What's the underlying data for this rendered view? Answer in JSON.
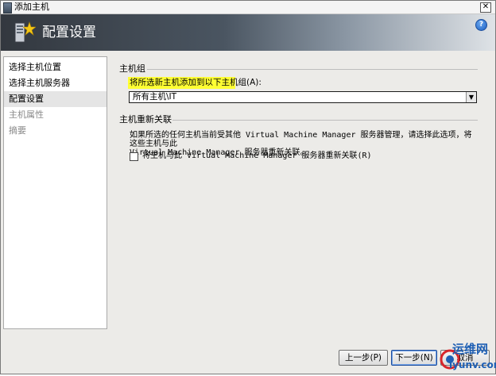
{
  "window": {
    "title": "添加主机"
  },
  "header": {
    "title": "配置设置"
  },
  "nav": {
    "items": [
      {
        "label": "选择主机位置",
        "state": "normal"
      },
      {
        "label": "选择主机服务器",
        "state": "normal"
      },
      {
        "label": "配置设置",
        "state": "selected"
      },
      {
        "label": "主机属性",
        "state": "disabled"
      },
      {
        "label": "摘要",
        "state": "disabled"
      }
    ]
  },
  "host_group": {
    "section_label": "主机组",
    "field_label": "将所选新主机添加到以下主机组(A):",
    "selected_value": "所有主机\\IT"
  },
  "reassociate": {
    "section_label": "主机重新关联",
    "description_line1": "如果所选的任何主机当前受其他 Virtual Machine Manager 服务器管理，请选择此选项，将这些主机与此",
    "description_line2": "Virtual Machine Manager 服务器重新关联。",
    "checkbox_label": "将主机与此 Virtual Machine Manager 服务器重新关联(R)",
    "checkbox_checked": false
  },
  "buttons": {
    "back": "上一步(P)",
    "next": "下一步(N)",
    "cancel": "取消"
  },
  "watermark": {
    "line1": "运维网",
    "line2": "iyunv.com"
  },
  "colors": {
    "highlight": "#ffff33",
    "watermark_red": "#d8262b",
    "watermark_blue": "#1e5fb4"
  }
}
